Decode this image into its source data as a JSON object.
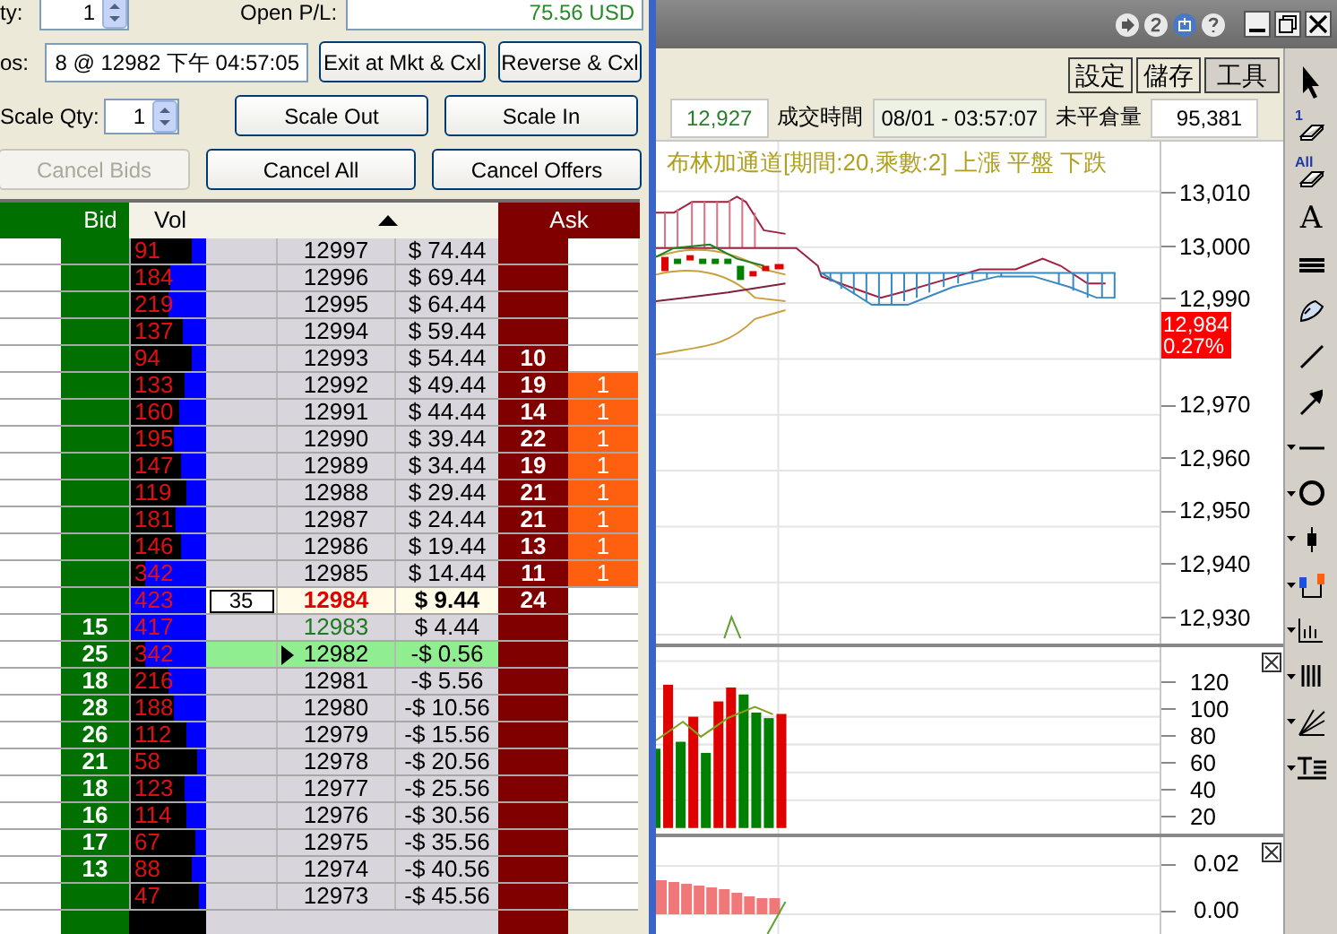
{
  "order_panel": {
    "qty_label": "ty:",
    "qty": "1",
    "open_pl_label": "Open P/L:",
    "open_pl": "75.56 USD",
    "pos_label": "os:",
    "pos": "8 @ 12982 下午 04:57:05",
    "scale_qty_label": "Scale Qty:",
    "scale_qty": "1",
    "position_buttons": [
      {
        "label": "Exit at Mkt & Cxl",
        "disabled": false
      },
      {
        "label": "Reverse & Cxl",
        "disabled": false
      }
    ],
    "scale_buttons": [
      {
        "label": "Scale Out",
        "disabled": false
      },
      {
        "label": "Scale In",
        "disabled": false
      }
    ],
    "cancel_buttons": [
      {
        "label": "Cancel Bids",
        "disabled": true
      },
      {
        "label": "Cancel All",
        "disabled": false
      },
      {
        "label": "Cancel Offers",
        "disabled": false
      }
    ]
  },
  "ladder": {
    "header": {
      "bid": "Bid",
      "vol": "Vol",
      "ask": "Ask"
    },
    "rows": [
      {
        "kind": "normal",
        "vol": "91",
        "level": 0.19,
        "price": "12997",
        "pnl": "$ 74.44"
      },
      {
        "kind": "normal",
        "vol": "184",
        "level": 0.48,
        "price": "12996",
        "pnl": "$ 69.44"
      },
      {
        "kind": "normal",
        "vol": "219",
        "level": 0.5,
        "price": "12995",
        "pnl": "$ 64.44"
      },
      {
        "kind": "normal",
        "vol": "137",
        "level": 0.31,
        "price": "12994",
        "pnl": "$ 59.44"
      },
      {
        "kind": "normal",
        "vol": "94",
        "level": 0.2,
        "price": "12993",
        "pnl": "$ 54.44",
        "ask": "10"
      },
      {
        "kind": "normal",
        "vol": "133",
        "level": 0.29,
        "price": "12992",
        "pnl": "$ 49.44",
        "ask": "19",
        "my_ask": "1"
      },
      {
        "kind": "normal",
        "vol": "160",
        "level": 0.36,
        "price": "12991",
        "pnl": "$ 44.44",
        "ask": "14",
        "my_ask": "1"
      },
      {
        "kind": "normal",
        "vol": "195",
        "level": 0.43,
        "price": "12990",
        "pnl": "$ 39.44",
        "ask": "22",
        "my_ask": "1"
      },
      {
        "kind": "normal",
        "vol": "147",
        "level": 0.33,
        "price": "12989",
        "pnl": "$ 34.44",
        "ask": "19",
        "my_ask": "1"
      },
      {
        "kind": "normal",
        "vol": "119",
        "level": 0.26,
        "price": "12988",
        "pnl": "$ 29.44",
        "ask": "21",
        "my_ask": "1"
      },
      {
        "kind": "normal",
        "vol": "181",
        "level": 0.41,
        "price": "12987",
        "pnl": "$ 24.44",
        "ask": "21",
        "my_ask": "1"
      },
      {
        "kind": "normal",
        "vol": "146",
        "level": 0.33,
        "price": "12986",
        "pnl": "$ 19.44",
        "ask": "13",
        "my_ask": "1"
      },
      {
        "kind": "normal",
        "vol": "342",
        "level": 0.81,
        "price": "12985",
        "pnl": "$ 14.44",
        "ask": "11",
        "my_ask": "1"
      },
      {
        "kind": "last",
        "vol": "423",
        "level": 1,
        "order": "35",
        "price": "12984",
        "pnl": "$ 9.44",
        "ask": "24"
      },
      {
        "kind": "best_bid",
        "bid": "15",
        "vol": "417",
        "level": 1,
        "price": "12983",
        "pnl": "$ 4.44"
      },
      {
        "kind": "position",
        "bid": "25",
        "vol": "342",
        "level": 0.81,
        "price": "12982",
        "pnl": "-$ 0.56"
      },
      {
        "kind": "normal",
        "bid": "18",
        "vol": "216",
        "level": 0.5,
        "price": "12981",
        "pnl": "-$ 5.56"
      },
      {
        "kind": "normal",
        "bid": "28",
        "vol": "188",
        "level": 0.43,
        "price": "12980",
        "pnl": "-$ 10.56"
      },
      {
        "kind": "normal",
        "bid": "26",
        "vol": "112",
        "level": 0.26,
        "price": "12979",
        "pnl": "-$ 15.56"
      },
      {
        "kind": "normal",
        "bid": "21",
        "vol": "58",
        "level": 0.12,
        "price": "12978",
        "pnl": "-$ 20.56"
      },
      {
        "kind": "normal",
        "bid": "18",
        "vol": "123",
        "level": 0.28,
        "price": "12977",
        "pnl": "-$ 25.56"
      },
      {
        "kind": "normal",
        "bid": "16",
        "vol": "114",
        "level": 0.26,
        "price": "12976",
        "pnl": "-$ 30.56"
      },
      {
        "kind": "normal",
        "bid": "17",
        "vol": "67",
        "level": 0.14,
        "price": "12975",
        "pnl": "-$ 35.56"
      },
      {
        "kind": "normal",
        "bid": "13",
        "vol": "88",
        "level": 0.18,
        "price": "12974",
        "pnl": "-$ 40.56"
      },
      {
        "kind": "normal",
        "vol": "47",
        "level": 0.1,
        "price": "12973",
        "pnl": "-$ 45.56"
      }
    ]
  },
  "chart_window": {
    "toolbar_buttons": [
      "設定",
      "儲存",
      "工具"
    ],
    "quote": [
      {
        "kind": "up_value",
        "text": "12,927"
      },
      {
        "kind": "label",
        "text": "成交時間"
      },
      {
        "kind": "time",
        "text": "08/01  -  03:57:07"
      },
      {
        "kind": "label",
        "text": "未平倉量"
      },
      {
        "kind": "value",
        "text": "95,381"
      }
    ],
    "legend": "布林加通道[期間:20,乘數:2] 上漲  平盤  下跌",
    "price_axis": [
      {
        "kind": "tick",
        "label": "13,010"
      },
      {
        "kind": "tick",
        "label": "13,000"
      },
      {
        "kind": "tick",
        "label": "12,990"
      },
      {
        "kind": "last",
        "price": "12,984",
        "change": "0.27%"
      },
      {
        "kind": "tick",
        "label": "12,970"
      },
      {
        "kind": "tick",
        "label": "12,960"
      },
      {
        "kind": "tick",
        "label": "12,950"
      },
      {
        "kind": "tick",
        "label": "12,940"
      },
      {
        "kind": "tick",
        "label": "12,930"
      }
    ],
    "volume_panel": {
      "ticks": [
        "120",
        "100",
        "80",
        "60",
        "40",
        "20"
      ]
    },
    "indicator_panel": {
      "ticks": [
        "0.02",
        "0.00"
      ]
    },
    "tools": [
      {
        "kind": "pointer"
      },
      {
        "kind": "eraser",
        "label": "1"
      },
      {
        "kind": "eraser",
        "label": "All"
      },
      {
        "kind": "text",
        "label": "A"
      },
      {
        "kind": "lines"
      },
      {
        "kind": "brush"
      },
      {
        "kind": "line"
      },
      {
        "kind": "arrow"
      },
      {
        "kind": "hline",
        "menu": true
      },
      {
        "kind": "circle",
        "menu": true
      },
      {
        "kind": "candle",
        "menu": true
      },
      {
        "kind": "candles",
        "menu": true
      },
      {
        "kind": "bars",
        "menu": true
      },
      {
        "kind": "vbars",
        "menu": true
      },
      {
        "kind": "fan",
        "menu": true
      },
      {
        "kind": "textstyle",
        "menu": true
      }
    ]
  }
}
